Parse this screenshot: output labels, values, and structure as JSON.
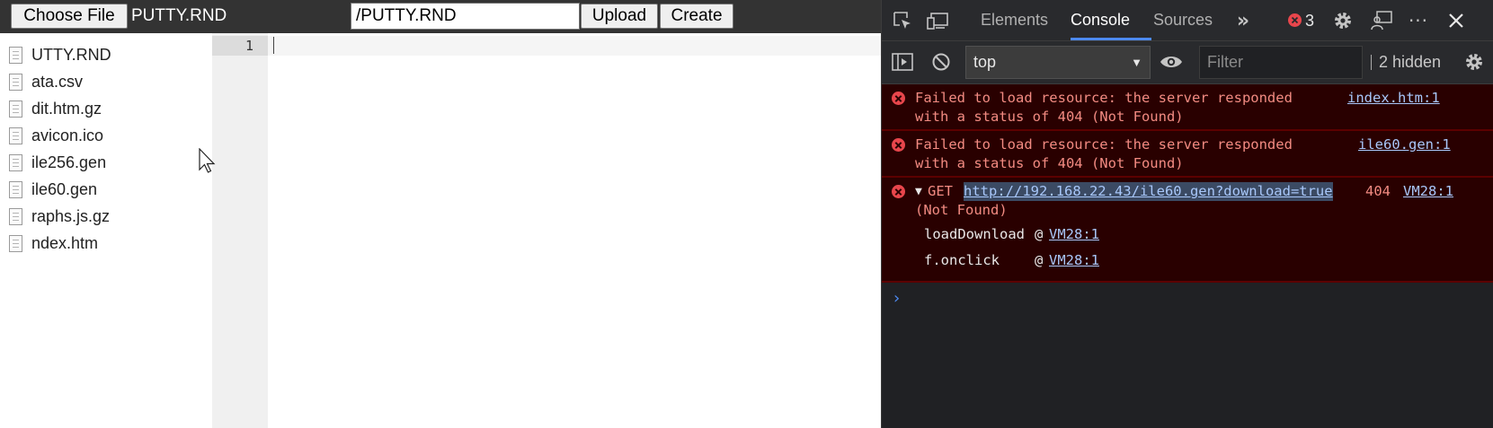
{
  "toolbar": {
    "choose_label": "Choose File",
    "file_name": "PUTTY.RND",
    "path_value": "/PUTTY.RND",
    "upload_label": "Upload",
    "create_label": "Create"
  },
  "files": [
    {
      "name": "UTTY.RND"
    },
    {
      "name": "ata.csv"
    },
    {
      "name": "dit.htm.gz"
    },
    {
      "name": "avicon.ico"
    },
    {
      "name": "ile256.gen"
    },
    {
      "name": "ile60.gen"
    },
    {
      "name": "raphs.js.gz"
    },
    {
      "name": "ndex.htm"
    }
  ],
  "editor": {
    "line_number": "1"
  },
  "devtools": {
    "tabs": {
      "elements": "Elements",
      "console": "Console",
      "sources": "Sources"
    },
    "error_count": "3",
    "context": "top",
    "filter_placeholder": "Filter",
    "hidden_count": "2 hidden",
    "messages": [
      {
        "line1": "Failed to load resource: the server responded",
        "line2": "with a status of 404 (Not Found)",
        "source": "index.htm:1"
      },
      {
        "line1": "Failed to load resource: the server responded",
        "line2": "with a status of 404 (Not Found)",
        "source": "ile60.gen:1"
      }
    ],
    "get_error": {
      "toggle": "▼",
      "method": "GET",
      "url": "http://192.168.22.43/ile60.gen?download=true",
      "status": "404",
      "status_text": "(Not Found)",
      "source": "VM28:1",
      "stack": [
        {
          "fn": "loadDownload",
          "at": "@",
          "src": "VM28:1"
        },
        {
          "fn": "f.onclick",
          "at": "@",
          "src": "VM28:1"
        }
      ]
    },
    "prompt": "›"
  },
  "colors": {
    "toolbar_bg": "#333333",
    "devtools_bg": "#202124",
    "error_bg": "#290000",
    "error_text": "#f28b82",
    "link": "#a8c7fa",
    "accent": "#4d8af0"
  }
}
